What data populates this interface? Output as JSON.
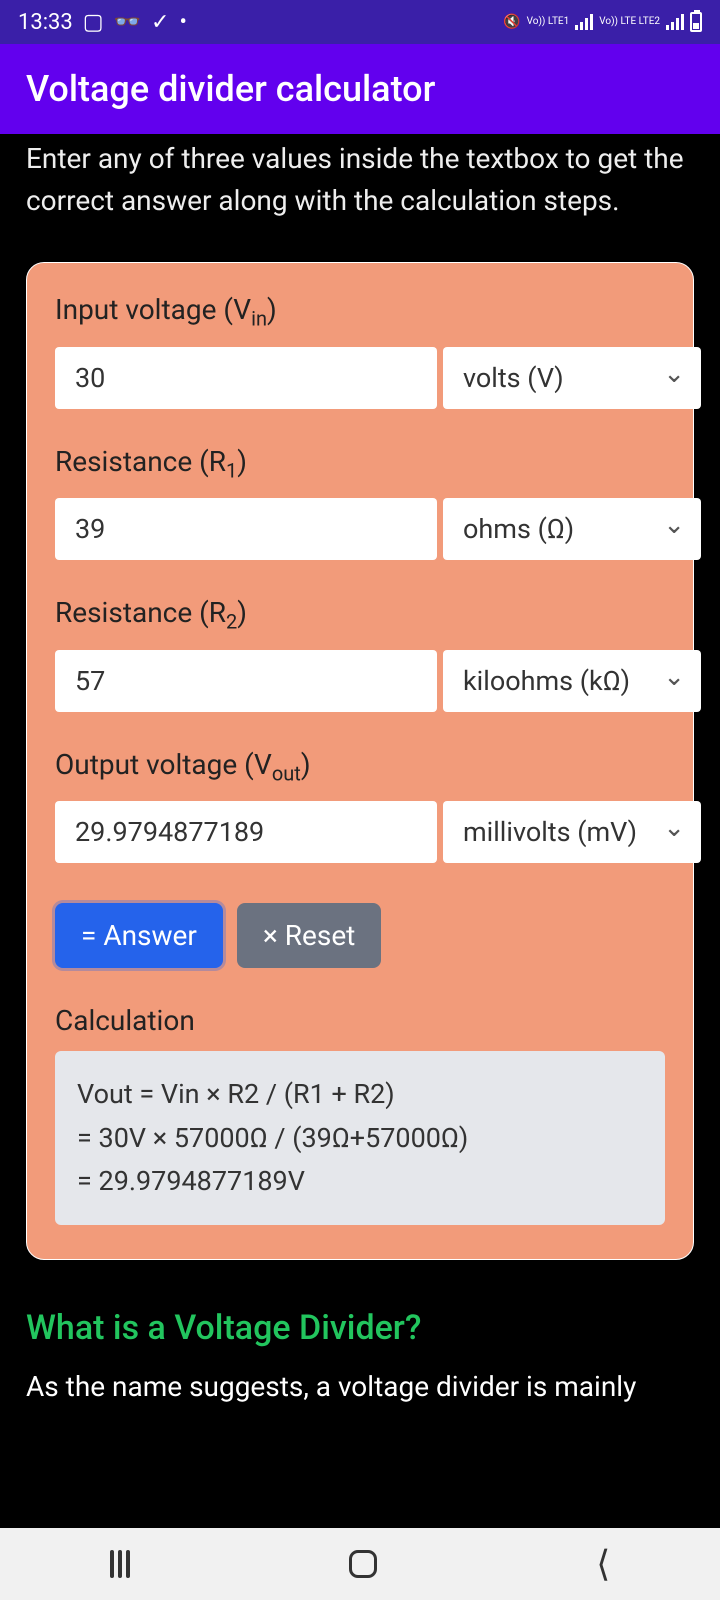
{
  "status": {
    "time": "13:33",
    "lte1": "Vo)) LTE1",
    "lte2": "Vo)) LTE LTE2"
  },
  "appbar": {
    "title": "Voltage divider calculator"
  },
  "intro": "Enter any of three values inside the textbox to get the correct answer along with the calculation steps.",
  "fields": {
    "vin": {
      "label_pre": "Input voltage (V",
      "label_sub": "in",
      "label_post": ")",
      "value": "30",
      "unit": "volts (V)"
    },
    "r1": {
      "label_pre": "Resistance (R",
      "label_sub": "1",
      "label_post": ")",
      "value": "39",
      "unit": "ohms (Ω)"
    },
    "r2": {
      "label_pre": "Resistance (R",
      "label_sub": "2",
      "label_post": ")",
      "value": "57",
      "unit": "kiloohms (kΩ)"
    },
    "vout": {
      "label_pre": "Output voltage (V",
      "label_sub": "out",
      "label_post": ")",
      "value": "29.9794877189",
      "unit": "millivolts (mV)"
    }
  },
  "buttons": {
    "answer": "= Answer",
    "reset": "× Reset"
  },
  "calculation": {
    "label": "Calculation",
    "text": "Vout = Vin × R2 / (R1 + R2)\n= 30V × 57000Ω / (39Ω+57000Ω)\n= 29.9794877189V"
  },
  "section": {
    "heading": "What is a Voltage Divider?",
    "body": "As the name suggests, a voltage divider is mainly"
  }
}
